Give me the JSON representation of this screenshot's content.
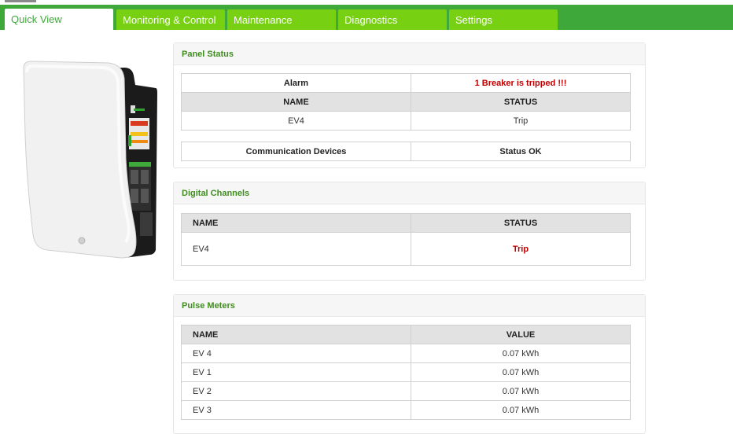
{
  "tabs": [
    {
      "label": "Quick View"
    },
    {
      "label": "Monitoring & Control"
    },
    {
      "label": "Maintenance"
    },
    {
      "label": "Diagnostics"
    },
    {
      "label": "Settings"
    }
  ],
  "panel_status": {
    "title": "Panel Status",
    "alarm_label": "Alarm",
    "alarm_value": "1 Breaker is tripped !!!",
    "col_name": "NAME",
    "col_status": "STATUS",
    "row_name": "EV4",
    "row_status": "Trip",
    "comm_label": "Communication Devices",
    "comm_value": "Status OK"
  },
  "digital_channels": {
    "title": "Digital Channels",
    "col_name": "NAME",
    "col_status": "STATUS",
    "rows": [
      {
        "name": "EV4",
        "status": "Trip"
      }
    ]
  },
  "pulse_meters": {
    "title": "Pulse Meters",
    "col_name": "NAME",
    "col_value": "VALUE",
    "rows": [
      {
        "name": "EV 4",
        "value": "0.07 kWh"
      },
      {
        "name": "EV 1",
        "value": "0.07 kWh"
      },
      {
        "name": "EV 2",
        "value": "0.07 kWh"
      },
      {
        "name": "EV 3",
        "value": "0.07 kWh"
      }
    ]
  },
  "colors": {
    "tab_bar": "#3ea83a",
    "tab": "#77d012",
    "accent": "#3f8f1e",
    "alarm": "#c00000"
  }
}
